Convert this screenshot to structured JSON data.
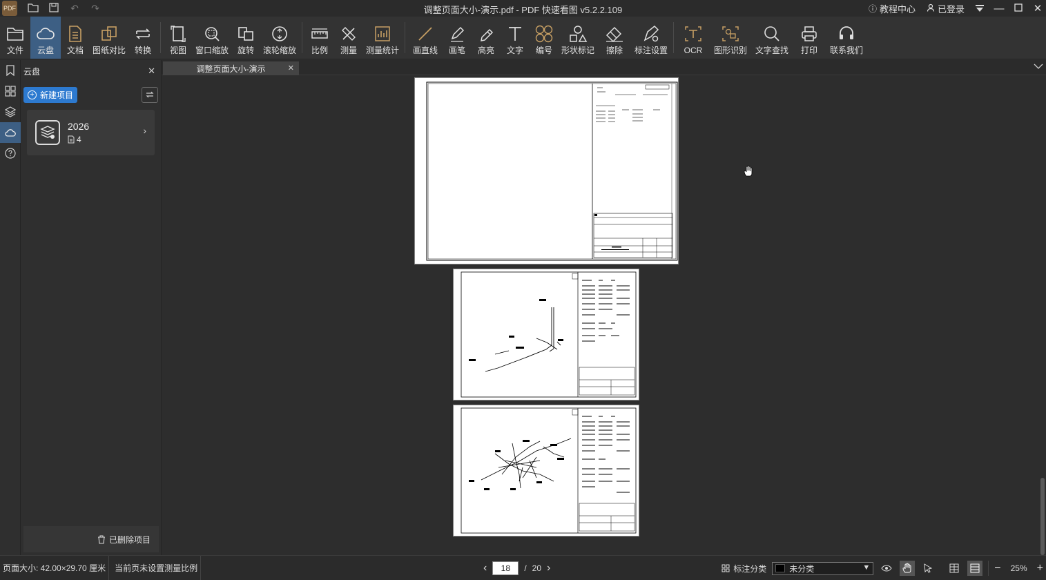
{
  "app": {
    "logo_text": "PDF",
    "window_title": "调整页面大小-演示.pdf - PDF 快速看图 v5.2.2.109",
    "help_center": "教程中心",
    "login_status": "已登录"
  },
  "toolbar": {
    "items": [
      {
        "label": "文件",
        "icon": "folder-icon"
      },
      {
        "label": "云盘",
        "icon": "cloud-icon",
        "active": true
      },
      {
        "label": "文档",
        "icon": "document-icon"
      },
      {
        "label": "图纸对比",
        "icon": "compare-icon"
      },
      {
        "label": "转换",
        "icon": "convert-icon"
      },
      {
        "label": "视图",
        "icon": "view-icon"
      },
      {
        "label": "窗口缩放",
        "icon": "zoom-window-icon"
      },
      {
        "label": "旋转",
        "icon": "rotate-icon"
      },
      {
        "label": "滚轮缩放",
        "icon": "mouse-wheel-icon"
      },
      {
        "label": "比例",
        "icon": "scale-ruler-icon"
      },
      {
        "label": "测量",
        "icon": "measure-icon"
      },
      {
        "label": "测量统计",
        "icon": "measure-stats-icon"
      },
      {
        "label": "画直线",
        "icon": "line-icon"
      },
      {
        "label": "画笔",
        "icon": "pen-icon"
      },
      {
        "label": "高亮",
        "icon": "highlighter-icon"
      },
      {
        "label": "文字",
        "icon": "text-icon"
      },
      {
        "label": "编号",
        "icon": "numbering-icon"
      },
      {
        "label": "形状标记",
        "icon": "shape-mark-icon"
      },
      {
        "label": "擦除",
        "icon": "eraser-icon"
      },
      {
        "label": "标注设置",
        "icon": "markup-settings-icon"
      },
      {
        "label": "OCR",
        "icon": "ocr-icon"
      },
      {
        "label": "图形识别",
        "icon": "shape-recognition-icon"
      },
      {
        "label": "文字查找",
        "icon": "search-icon"
      },
      {
        "label": "打印",
        "icon": "printer-icon"
      },
      {
        "label": "联系我们",
        "icon": "headset-icon"
      }
    ]
  },
  "sidebar": {
    "title": "云盘",
    "new_project": "新建项目",
    "project": {
      "name": "2026",
      "file_count": "4"
    },
    "deleted_items": "已删除项目"
  },
  "tab": {
    "label": "调整页面大小-演示"
  },
  "status": {
    "page_size": "页面大小: 42.00×29.70 厘米",
    "scale_note": "当前页未设置测量比例",
    "current_page": "18",
    "page_separator": "/",
    "total_pages": "20",
    "annotation_category_label": "标注分类",
    "category_value": "未分类",
    "category_color": "#000000",
    "zoom": "25%"
  },
  "colors": {
    "accent": "#2d7ad0",
    "active_tool": "#3d5f84",
    "icon_gold": "#c8a064"
  }
}
